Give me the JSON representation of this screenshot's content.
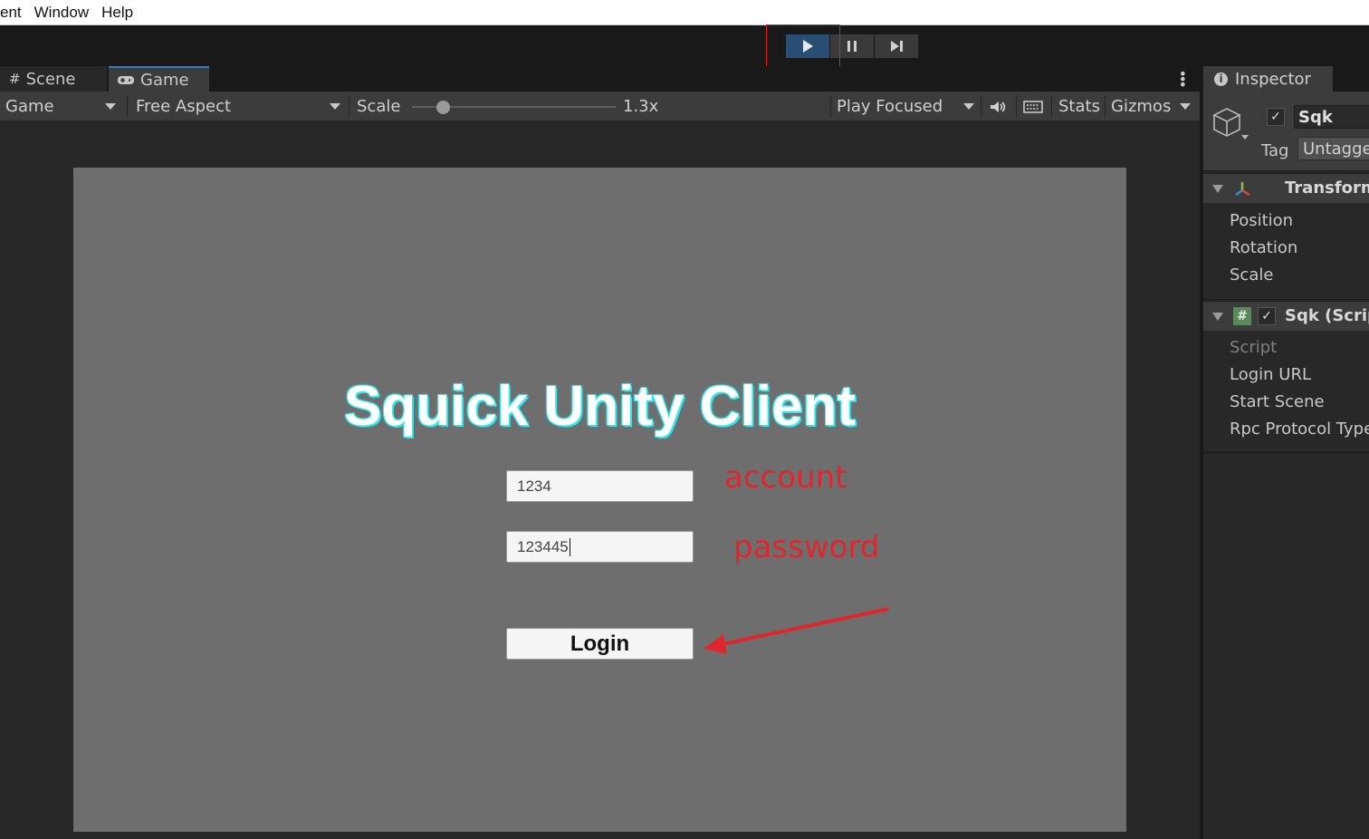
{
  "menubar": {
    "items": [
      "ent",
      "Window",
      "Help"
    ]
  },
  "playbar": {
    "play": "play-icon",
    "pause": "pause-icon",
    "step": "step-icon"
  },
  "game_panel": {
    "tabs": [
      {
        "label": "Scene",
        "icon": "hash-icon"
      },
      {
        "label": "Game",
        "icon": "gamepad-icon"
      }
    ],
    "toolbar": {
      "display": "Game",
      "aspect": "Free Aspect",
      "scale_label": "Scale",
      "scale_value": "1.3x",
      "play_mode": "Play Focused",
      "stats": "Stats",
      "gizmos": "Gizmos"
    },
    "view": {
      "title": "Squick Unity Client",
      "account_value": "1234",
      "password_value": "123445",
      "login_label": "Login",
      "account_note": "account",
      "password_note": "password"
    }
  },
  "inspector": {
    "tab": "Inspector",
    "object_name": "Sqk",
    "tag_label": "Tag",
    "tag_value": "Untagged",
    "transform": {
      "title": "Transform",
      "props": [
        "Position",
        "Rotation",
        "Scale"
      ]
    },
    "script_component": {
      "title": "Sqk (Script)",
      "props": [
        "Script",
        "Login URL",
        "Start Scene",
        "Rpc Protocol Type"
      ]
    }
  },
  "colors": {
    "accent_blue": "#2a4e73",
    "annotation_red": "#e0262d",
    "title_glow": "#30e8ef"
  }
}
